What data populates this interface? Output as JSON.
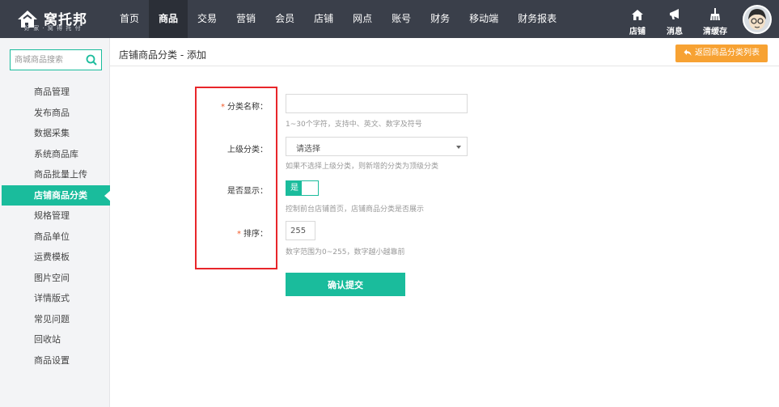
{
  "brand": {
    "name": "窝托邦",
    "slogan": "好 家 · 窝 得 托 付"
  },
  "nav": {
    "items": [
      {
        "label": "首页"
      },
      {
        "label": "商品"
      },
      {
        "label": "交易"
      },
      {
        "label": "营销"
      },
      {
        "label": "会员"
      },
      {
        "label": "店铺"
      },
      {
        "label": "网点"
      },
      {
        "label": "账号"
      },
      {
        "label": "财务"
      },
      {
        "label": "移动端"
      },
      {
        "label": "财务报表"
      }
    ],
    "active": "商品"
  },
  "tools": {
    "store": {
      "label": "店铺",
      "icon": "home-icon"
    },
    "messages": {
      "label": "消息",
      "icon": "megaphone-icon"
    },
    "clear_cache": {
      "label": "清缓存",
      "icon": "broom-icon"
    }
  },
  "sidebar": {
    "search_placeholder": "商城商品搜索",
    "items": [
      {
        "label": "商品管理"
      },
      {
        "label": "发布商品"
      },
      {
        "label": "数据采集"
      },
      {
        "label": "系统商品库"
      },
      {
        "label": "商品批量上传"
      },
      {
        "label": "店铺商品分类"
      },
      {
        "label": "规格管理"
      },
      {
        "label": "商品单位"
      },
      {
        "label": "运费模板"
      },
      {
        "label": "图片空间"
      },
      {
        "label": "详情版式"
      },
      {
        "label": "常见问题"
      },
      {
        "label": "回收站"
      },
      {
        "label": "商品设置"
      }
    ],
    "active": "店铺商品分类"
  },
  "page": {
    "title": "店铺商品分类 - 添加",
    "back_button": "返回商品分类列表"
  },
  "form": {
    "name": {
      "required_mark": "*",
      "label": "分类名称：",
      "value": "",
      "hint": "1~30个字符，支持中、英文、数字及符号"
    },
    "parent": {
      "label": "上级分类：",
      "selected": "请选择",
      "hint": "如果不选择上级分类，则新增的分类为顶级分类"
    },
    "visible": {
      "label": "是否显示：",
      "on_text": "是",
      "state": true,
      "hint": "控制前台店铺首页，店铺商品分类是否展示"
    },
    "sort": {
      "required_mark": "*",
      "label": "排序：",
      "value": "255",
      "hint": "数字范围为0~255，数字越小越靠前"
    },
    "submit": "确认提交"
  },
  "colors": {
    "topbar": "#3a3f4a",
    "accent": "#1abc9c",
    "back_button": "#f7a233",
    "highlight_box": "#e8262a"
  }
}
